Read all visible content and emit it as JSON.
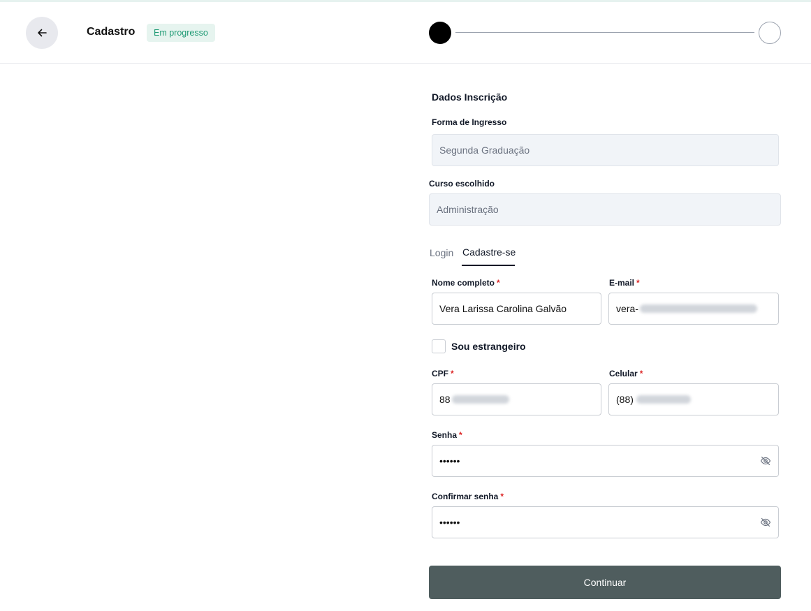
{
  "header": {
    "title": "Cadastro",
    "status": "Em progresso"
  },
  "form": {
    "section_title": "Dados Inscrição",
    "ingresso": {
      "label": "Forma de Ingresso",
      "value": "Segunda Graduação"
    },
    "curso": {
      "label": "Curso escolhido",
      "value": "Administração"
    },
    "tabs": [
      {
        "label": "Login",
        "active": false
      },
      {
        "label": "Cadastre-se",
        "active": true
      }
    ],
    "nome": {
      "label": "Nome completo",
      "value": "Vera Larissa Carolina Galvão"
    },
    "email": {
      "label": "E-mail",
      "value_visible": "vera-"
    },
    "estrangeiro": {
      "label": "Sou estrangeiro",
      "checked": false
    },
    "cpf": {
      "label": "CPF",
      "value_visible": "88"
    },
    "celular": {
      "label": "Celular",
      "value_visible": "(88)"
    },
    "senha": {
      "label": "Senha",
      "value": "••••••"
    },
    "confirmar": {
      "label": "Confirmar senha",
      "value": "••••••"
    },
    "required_mark": "*",
    "submit_label": "Continuar"
  },
  "icons": {
    "back": "arrow-left-icon",
    "password_toggle": "eye-off-icon"
  },
  "colors": {
    "badge_bg": "#e6f4ef",
    "badge_text": "#1f9a74",
    "button_bg": "#4f5d5e",
    "required": "#dc2626"
  }
}
